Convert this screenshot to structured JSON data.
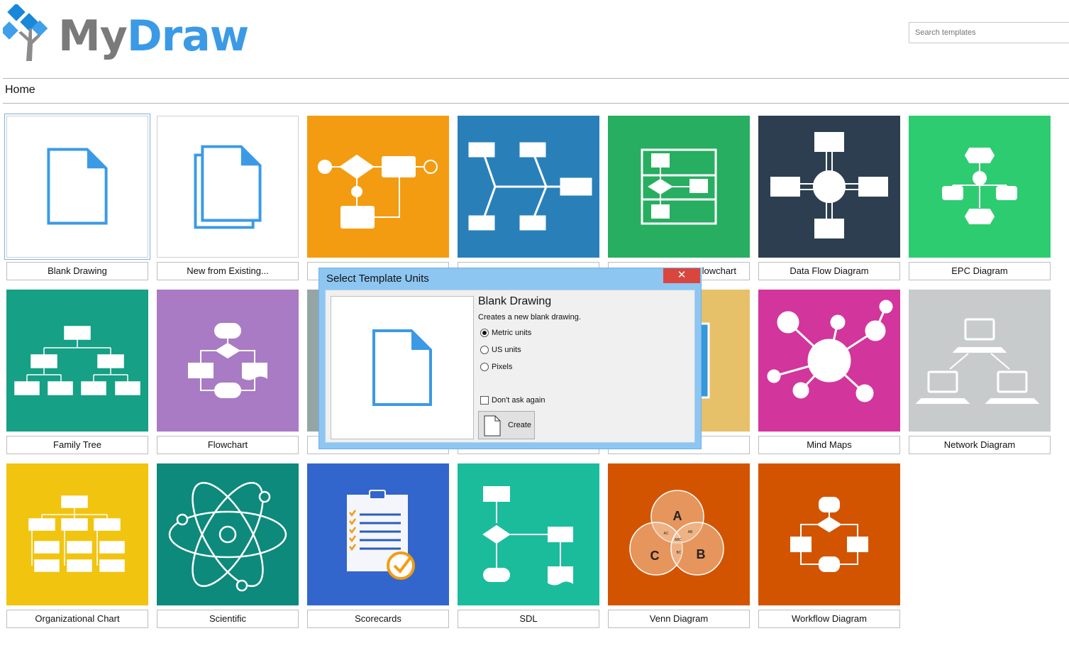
{
  "app": {
    "logo_my": "My",
    "logo_draw": "Draw"
  },
  "search": {
    "placeholder": "Search templates"
  },
  "breadcrumb": {
    "home": "Home"
  },
  "tiles": [
    {
      "label": "Blank Drawing",
      "color": "#ffffff",
      "icon": "blank-document-icon"
    },
    {
      "label": "New from Existing...",
      "color": "#ffffff",
      "icon": "documents-icon"
    },
    {
      "label": "",
      "color": "#f39c12",
      "icon": "bpmn-icon"
    },
    {
      "label": "",
      "color": "#2980b9",
      "icon": "fishbone-icon"
    },
    {
      "label": "lowchart",
      "color": "#27ae60",
      "icon": "cross-functional-flowchart-icon"
    },
    {
      "label": "Data Flow Diagram",
      "color": "#2c3e50",
      "icon": "data-flow-icon"
    },
    {
      "label": "EPC Diagram",
      "color": "#2ecc71",
      "icon": "epc-icon"
    },
    {
      "label": "Family Tree",
      "color": "#16a085",
      "icon": "family-tree-icon"
    },
    {
      "label": "Flowchart",
      "color": "#a97bc4",
      "icon": "flowchart-icon"
    },
    {
      "label": "",
      "color": "#95a5a6",
      "icon": "hidden-icon"
    },
    {
      "label": "",
      "color": "#3498db",
      "icon": "hidden-icon"
    },
    {
      "label": "",
      "color": "#e7c06a",
      "icon": "hidden-icon"
    },
    {
      "label": "Mind Maps",
      "color": "#d2359b",
      "icon": "mind-map-icon"
    },
    {
      "label": "Network Diagram",
      "color": "#c8cbcc",
      "icon": "network-icon"
    },
    {
      "label": "Organizational Chart",
      "color": "#f1c40f",
      "icon": "org-chart-icon"
    },
    {
      "label": "Scientific",
      "color": "#0d8a7c",
      "icon": "atom-icon"
    },
    {
      "label": "Scorecards",
      "color": "#3366cc",
      "icon": "scorecard-icon"
    },
    {
      "label": "SDL",
      "color": "#1abc9c",
      "icon": "sdl-icon"
    },
    {
      "label": "Venn Diagram",
      "color": "#d35400",
      "icon": "venn-icon"
    },
    {
      "label": "Workflow Diagram",
      "color": "#d35400",
      "icon": "workflow-icon"
    }
  ],
  "venn": {
    "a": "A",
    "b": "B",
    "c": "C",
    "ab": "AB",
    "ac": "AC",
    "bc": "BC",
    "abc": "ABC"
  },
  "dialog": {
    "title": "Select Template Units",
    "close": "✕",
    "heading": "Blank Drawing",
    "description": "Creates a new blank drawing.",
    "options": [
      "Metric units",
      "US units",
      "Pixels"
    ],
    "selected_option": "Metric units",
    "dont_ask": "Don't ask again",
    "create": "Create"
  }
}
